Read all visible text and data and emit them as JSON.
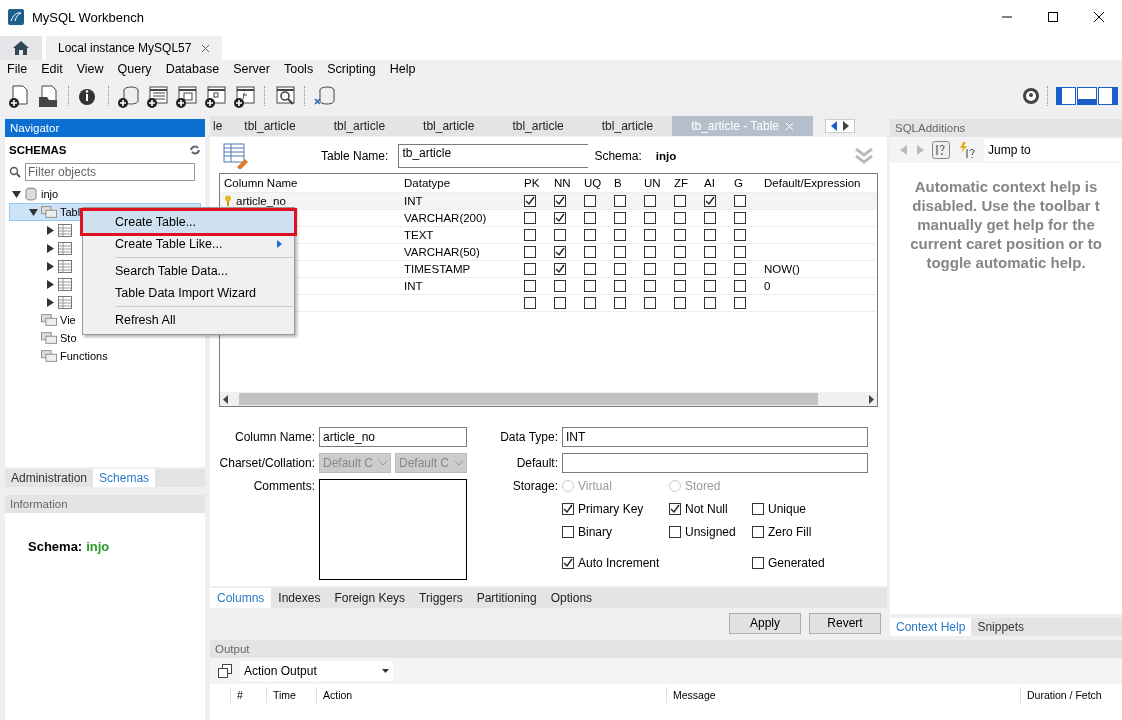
{
  "window": {
    "title": "MySQL Workbench"
  },
  "connection_tabs": [
    {
      "kind": "home"
    },
    {
      "kind": "connection",
      "label": "Local instance MySQL57"
    }
  ],
  "menu": [
    "File",
    "Edit",
    "View",
    "Query",
    "Database",
    "Server",
    "Tools",
    "Scripting",
    "Help"
  ],
  "navigator": {
    "title": "Navigator",
    "schemas_title": "SCHEMAS",
    "filter": {
      "placeholder": "Filter objects"
    },
    "tree": [
      {
        "kind": "schema",
        "label": "injo",
        "expanded": true,
        "selected": false,
        "children": [
          {
            "kind": "folder",
            "label": "Tabl",
            "expanded": true,
            "selected": true,
            "children": [
              {
                "kind": "table",
                "expanded": false,
                "selected": false
              },
              {
                "kind": "table",
                "expanded": false,
                "selected": false
              },
              {
                "kind": "table",
                "expanded": false,
                "selected": false
              },
              {
                "kind": "table",
                "expanded": false,
                "selected": false
              },
              {
                "kind": "table",
                "expanded": false,
                "selected": false
              }
            ]
          },
          {
            "kind": "folder",
            "label": "Vie",
            "selected": false
          },
          {
            "kind": "folder",
            "label": "Sto",
            "selected": false
          },
          {
            "kind": "folder",
            "label": "Functions",
            "selected": false
          }
        ]
      }
    ],
    "tabs": [
      {
        "label": "Administration",
        "selected": false
      },
      {
        "label": "Schemas",
        "selected": true
      }
    ]
  },
  "information": {
    "title": "Information",
    "schema_label": "Schema:",
    "schema_value": "injo"
  },
  "context_menu": {
    "items": [
      {
        "kind": "item",
        "label": "Create Table...",
        "highlighted": true,
        "submenu": false
      },
      {
        "kind": "item",
        "label": "Create Table Like...",
        "highlighted": false,
        "submenu": true
      },
      {
        "kind": "separator"
      },
      {
        "kind": "item",
        "label": "Search Table Data...",
        "highlighted": false,
        "submenu": false
      },
      {
        "kind": "item",
        "label": "Table Data Import Wizard",
        "highlighted": false,
        "submenu": false
      },
      {
        "kind": "separator"
      },
      {
        "kind": "item",
        "label": "Refresh All",
        "highlighted": false,
        "submenu": false
      }
    ]
  },
  "editor_tabs": [
    {
      "label": "le",
      "selected": false,
      "closable": false
    },
    {
      "label": "tbl_article",
      "selected": false,
      "closable": false
    },
    {
      "label": "tbl_article",
      "selected": false,
      "closable": false
    },
    {
      "label": "tbl_article",
      "selected": false,
      "closable": false
    },
    {
      "label": "tbl_article",
      "selected": false,
      "closable": false
    },
    {
      "label": "tbl_article",
      "selected": false,
      "closable": false
    },
    {
      "label": "tb_article - Table",
      "selected": true,
      "closable": true
    }
  ],
  "table_editor": {
    "table_name_label": "Table Name:",
    "table_name": "tb_article",
    "schema_label": "Schema:",
    "schema": "injo",
    "columns": [
      "Column Name",
      "Datatype",
      "PK",
      "NN",
      "UQ",
      "B",
      "UN",
      "ZF",
      "AI",
      "G",
      "Default/Expression"
    ],
    "rows": [
      {
        "name": "article_no",
        "key": true,
        "datatype": "INT",
        "flags": [
          true,
          true,
          false,
          false,
          false,
          false,
          true,
          false
        ]
      },
      {
        "datatype": "VARCHAR(200)",
        "flags": [
          false,
          true,
          false,
          false,
          false,
          false,
          false,
          false
        ]
      },
      {
        "datatype": "TEXT",
        "flags": [
          false,
          false,
          false,
          false,
          false,
          false,
          false,
          false
        ]
      },
      {
        "datatype": "VARCHAR(50)",
        "flags": [
          false,
          true,
          false,
          false,
          false,
          false,
          false,
          false
        ]
      },
      {
        "datatype": "TIMESTAMP",
        "flags": [
          false,
          true,
          false,
          false,
          false,
          false,
          false,
          false
        ],
        "default": "NOW()"
      },
      {
        "datatype": "INT",
        "flags": [
          false,
          false,
          false,
          false,
          false,
          false,
          false,
          false
        ],
        "default": "0"
      },
      {
        "flags": [
          false,
          false,
          false,
          false,
          false,
          false,
          false,
          false
        ]
      }
    ]
  },
  "column_details": {
    "column_name_label": "Column Name:",
    "column_name": "article_no",
    "data_type_label": "Data Type:",
    "data_type": "INT",
    "charset_label": "Charset/Collation:",
    "charset": "Default C",
    "collation": "Default C",
    "default_label": "Default:",
    "comments_label": "Comments:",
    "storage_label": "Storage:",
    "storage_options": [
      {
        "label": "Virtual",
        "selected": false,
        "disabled": true
      },
      {
        "label": "Stored",
        "selected": false,
        "disabled": true
      }
    ],
    "options": [
      {
        "label": "Primary Key",
        "checked": true
      },
      {
        "label": "Not Null",
        "checked": true
      },
      {
        "label": "Unique",
        "checked": false
      },
      {
        "label": "Binary",
        "checked": false
      },
      {
        "label": "Unsigned",
        "checked": false
      },
      {
        "label": "Zero Fill",
        "checked": false
      },
      {
        "label": "Auto Increment",
        "checked": true
      },
      {
        "label": "Generated",
        "checked": false
      }
    ]
  },
  "bottom_tabs": [
    {
      "label": "Columns",
      "selected": true
    },
    {
      "label": "Indexes",
      "selected": false
    },
    {
      "label": "Foreign Keys",
      "selected": false
    },
    {
      "label": "Triggers",
      "selected": false
    },
    {
      "label": "Partitioning",
      "selected": false
    },
    {
      "label": "Options",
      "selected": false
    }
  ],
  "buttons": [
    "Apply",
    "Revert"
  ],
  "sql_additions": {
    "title": "SQLAdditions",
    "jump_to": "Jump to",
    "help_lines": [
      "Automatic context help is",
      "disabled. Use the toolbar t",
      "manually get help for the",
      "current caret position or to",
      "toggle automatic help."
    ],
    "tabs": [
      {
        "label": "Context Help",
        "selected": true
      },
      {
        "label": "Snippets",
        "selected": false
      }
    ]
  },
  "output": {
    "title": "Output",
    "selector": "Action Output",
    "columns": [
      "#",
      "Time",
      "Action",
      "Message",
      "Duration / Fetch"
    ]
  }
}
